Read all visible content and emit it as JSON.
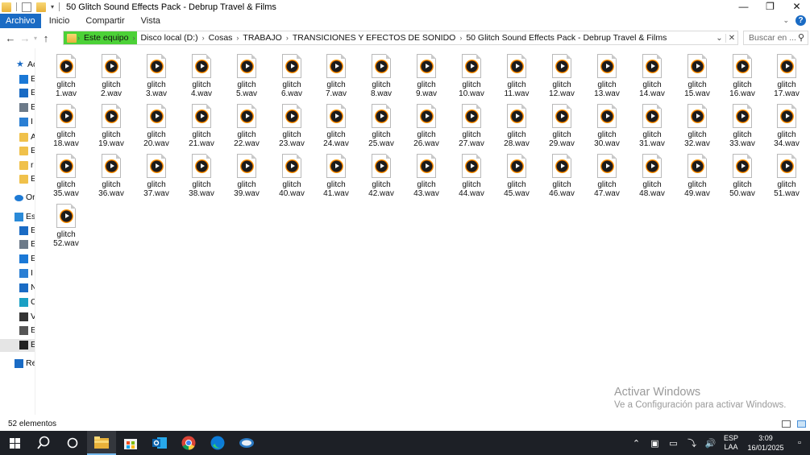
{
  "window": {
    "title": "50 Glitch Sound Effects Pack - Debrup Travel & Films",
    "controls": [
      "minimize",
      "maximize",
      "close"
    ]
  },
  "ribbon": {
    "tabs": [
      {
        "label": "Archivo",
        "active": true
      },
      {
        "label": "Inicio",
        "active": false
      },
      {
        "label": "Compartir",
        "active": false
      },
      {
        "label": "Vista",
        "active": false
      }
    ]
  },
  "address": {
    "breadcrumbs": [
      "Este equipo",
      "Disco local (D:)",
      "Cosas",
      "TRABAJO",
      "TRANSICIONES Y EFECTOS DE SONIDO",
      "50 Glitch Sound Effects Pack - Debrup Travel & Films"
    ],
    "search_placeholder": "Buscar en ..."
  },
  "sidebar": {
    "items": [
      {
        "icon": "star-icon",
        "label": "Ac",
        "color": "#1a6bc4"
      },
      {
        "icon": "desktop-icon",
        "label": "E",
        "color": "#1a78d6"
      },
      {
        "icon": "download-icon",
        "label": "E",
        "color": "#1a6bc4"
      },
      {
        "icon": "document-icon",
        "label": "E",
        "color": "#6c7a89"
      },
      {
        "icon": "image-icon",
        "label": "I",
        "color": "#2a7fd4"
      },
      {
        "icon": "folder-icon",
        "label": "A",
        "color": "#f0c14b"
      },
      {
        "icon": "folder-icon",
        "label": "E",
        "color": "#f0c14b"
      },
      {
        "icon": "folder-icon",
        "label": "r",
        "color": "#f0c14b"
      },
      {
        "icon": "folder-icon",
        "label": "E",
        "color": "#f0c14b"
      },
      {
        "icon": "cloud-icon",
        "label": "Or",
        "color": "#1e7ad4"
      },
      {
        "icon": "computer-icon",
        "label": "Es",
        "color": "#2a8ad8"
      },
      {
        "icon": "download-icon",
        "label": "E",
        "color": "#1a6bc4"
      },
      {
        "icon": "document-icon",
        "label": "E",
        "color": "#6c7a89"
      },
      {
        "icon": "desktop-icon",
        "label": "E",
        "color": "#1a78d6"
      },
      {
        "icon": "image-icon",
        "label": "I",
        "color": "#2a7fd4"
      },
      {
        "icon": "music-icon",
        "label": "N",
        "color": "#1a6bc4"
      },
      {
        "icon": "cube-icon",
        "label": "C",
        "color": "#1aa0c4"
      },
      {
        "icon": "video-icon",
        "label": "V",
        "color": "#333333"
      },
      {
        "icon": "drive-icon",
        "label": "E",
        "color": "#555555"
      },
      {
        "icon": "drive-icon",
        "label": "E",
        "color": "#222222"
      },
      {
        "icon": "network-icon",
        "label": "Re",
        "color": "#1a6bc4"
      }
    ]
  },
  "files": [
    "glitch 1.wav",
    "glitch 2.wav",
    "glitch 3.wav",
    "glitch 4.wav",
    "glitch 5.wav",
    "glitch 6.wav",
    "glitch 7.wav",
    "glitch 8.wav",
    "glitch 9.wav",
    "glitch 10.wav",
    "glitch 11.wav",
    "glitch 12.wav",
    "glitch 13.wav",
    "glitch 14.wav",
    "glitch 15.wav",
    "glitch 16.wav",
    "glitch 17.wav",
    "glitch 18.wav",
    "glitch 19.wav",
    "glitch 20.wav",
    "glitch 21.wav",
    "glitch 22.wav",
    "glitch 23.wav",
    "glitch 24.wav",
    "glitch 25.wav",
    "glitch 26.wav",
    "glitch 27.wav",
    "glitch 28.wav",
    "glitch 29.wav",
    "glitch 30.wav",
    "glitch 31.wav",
    "glitch 32.wav",
    "glitch 33.wav",
    "glitch 34.wav",
    "glitch 35.wav",
    "glitch 36.wav",
    "glitch 37.wav",
    "glitch 38.wav",
    "glitch 39.wav",
    "glitch 40.wav",
    "glitch 41.wav",
    "glitch 42.wav",
    "glitch 43.wav",
    "glitch 44.wav",
    "glitch 45.wav",
    "glitch 46.wav",
    "glitch 47.wav",
    "glitch 48.wav",
    "glitch 49.wav",
    "glitch 50.wav",
    "glitch 51.wav",
    "glitch 52.wav"
  ],
  "watermark": {
    "line1": "Activar Windows",
    "line2": "Ve a Configuración para activar Windows."
  },
  "status": {
    "count": "52 elementos"
  },
  "taskbar": {
    "apps": [
      "start-icon",
      "search-icon",
      "cortana-icon",
      "file-explorer-icon",
      "store-icon",
      "outlook-icon",
      "chrome-icon",
      "edge-icon",
      "app-icon"
    ],
    "language": "ESP",
    "layout": "LAA",
    "time": "3:09",
    "date": "16/01/2025"
  },
  "colors": {
    "accent": "#1a6bc4",
    "breadcrumb_highlight": "#4cd137",
    "taskbar": "#1d2026"
  }
}
